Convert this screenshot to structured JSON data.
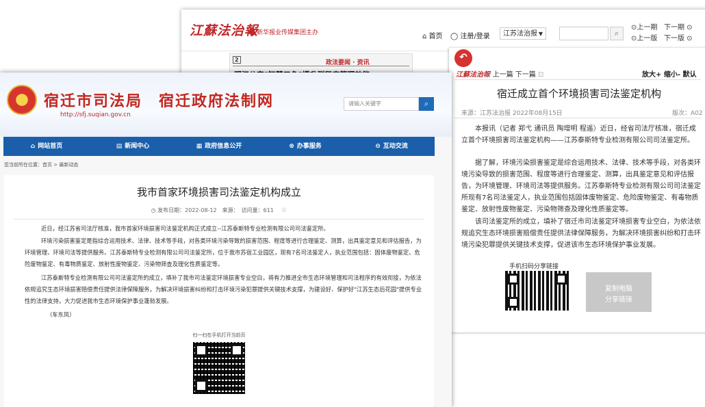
{
  "back_site": {
    "logo": "江蘇法治報",
    "logo_sub": "新华报业传媒集团主办",
    "nav": {
      "home": "首页",
      "login": "注册/登录",
      "select": "江苏法治报"
    },
    "paging": [
      "上一期",
      "下一期",
      "上一版",
      "下一版"
    ],
    "newspaper": {
      "page_tag": "政法要闻 · 资讯",
      "headline": "邗江公安\"智慧三色\"提升群租房管理效能",
      "page_no": "2"
    },
    "panel": {
      "logo": "江蘇法治報",
      "links": "上一篇 下一篇",
      "zoom": "放大+ 缩小- 默认",
      "title": "宿迁成立首个环境损害司法鉴定机构",
      "source": "来源：江苏法治报    2022年08月15日",
      "edition": "版次：A02",
      "paragraphs": [
        "本报讯（记者 郑弋 通讯员 陶增明 程遥）近日，经省司法厅核准，宿迁成立首个环境损害司法鉴定机构——江苏泰斯特专业检测有限公司司法鉴定所。",
        "据了解，环境污染损害鉴定是综合运用技术、法律、技术等手段，对各类环境污染导致的损害范围、程度等进行合理鉴定、测算，出具鉴定意见和评估报告，为环境管理、环境司法等提供服务。江苏泰斯特专业检测有限公司司法鉴定所现有7名司法鉴定人，执业范围包括固体废物鉴定、危险废物鉴定、有毒物质鉴定、放射性废物鉴定、污染物筛查及理化性质鉴定等。",
        "该司法鉴定所的成立，填补了宿迁市司法鉴定环境损害专业空白，为依法依规追究生态环境损害赔偿责任提供法律保障服务，为解决环境损害纠纷和打击环境污染犯罪提供关键技术支撑，促进该市生态环境保护事业发展。"
      ],
      "share_label": "手机扫码分享链接",
      "copy_btn": [
        "复制电脑",
        "分享链接"
      ]
    }
  },
  "front_site": {
    "title": "宿迁市司法局　宿迁政府法制网",
    "url": "http://sfj.suqian.gov.cn",
    "search_placeholder": "请输入关键字",
    "menu": [
      "网站首页",
      "新闻中心",
      "政府信息公开",
      "办事服务",
      "互动交流"
    ],
    "breadcrumb": "您当前所在位置：首页 > 最新动态",
    "article": {
      "title": "我市首家环境损害司法鉴定机构成立",
      "meta": "发布日期：2022-08-12　来源：　访问量：611",
      "paragraphs": [
        "近日，经江苏省司法厅核准，我市首家环境损害司法鉴定机构正式成立--江苏泰斯特专业检测有限公司司法鉴定所。",
        "环境污染损害鉴定是指综合运用技术、法律、技术等手段，对各类环境污染导致的损害范围、程度等进行合理鉴定、测算，出具鉴定意见和评估报告，为环境管理、环境司法等提供服务。江苏泰斯特专业检测有限公司司法鉴定所，位于我市苏宿工业园区，现有7名司法鉴定人，执业范围包括：固体废物鉴定、危险废物鉴定、有毒物质鉴定、放射性废物鉴定、污染物筛查及理化性质鉴定等。",
        "江苏泰斯特专业检测有限公司司法鉴定所的成立，填补了我市司法鉴定环境损害专业空白，将有力推进全市生态环境管理和司法程序的有效衔接，为依法依规追究生态环境损害赔偿责任提供法律保障服务，为解决环境损害纠纷和打击环境污染犯罪提供关键技术支撑，为建设好、保护好\"江苏生态后花园\"提供专业性的法律支持，大力促进我市生态环境保护事业蓬勃发展。",
        "（车东凤）"
      ],
      "scan_label": "扫一扫在手机打开当前页"
    }
  }
}
